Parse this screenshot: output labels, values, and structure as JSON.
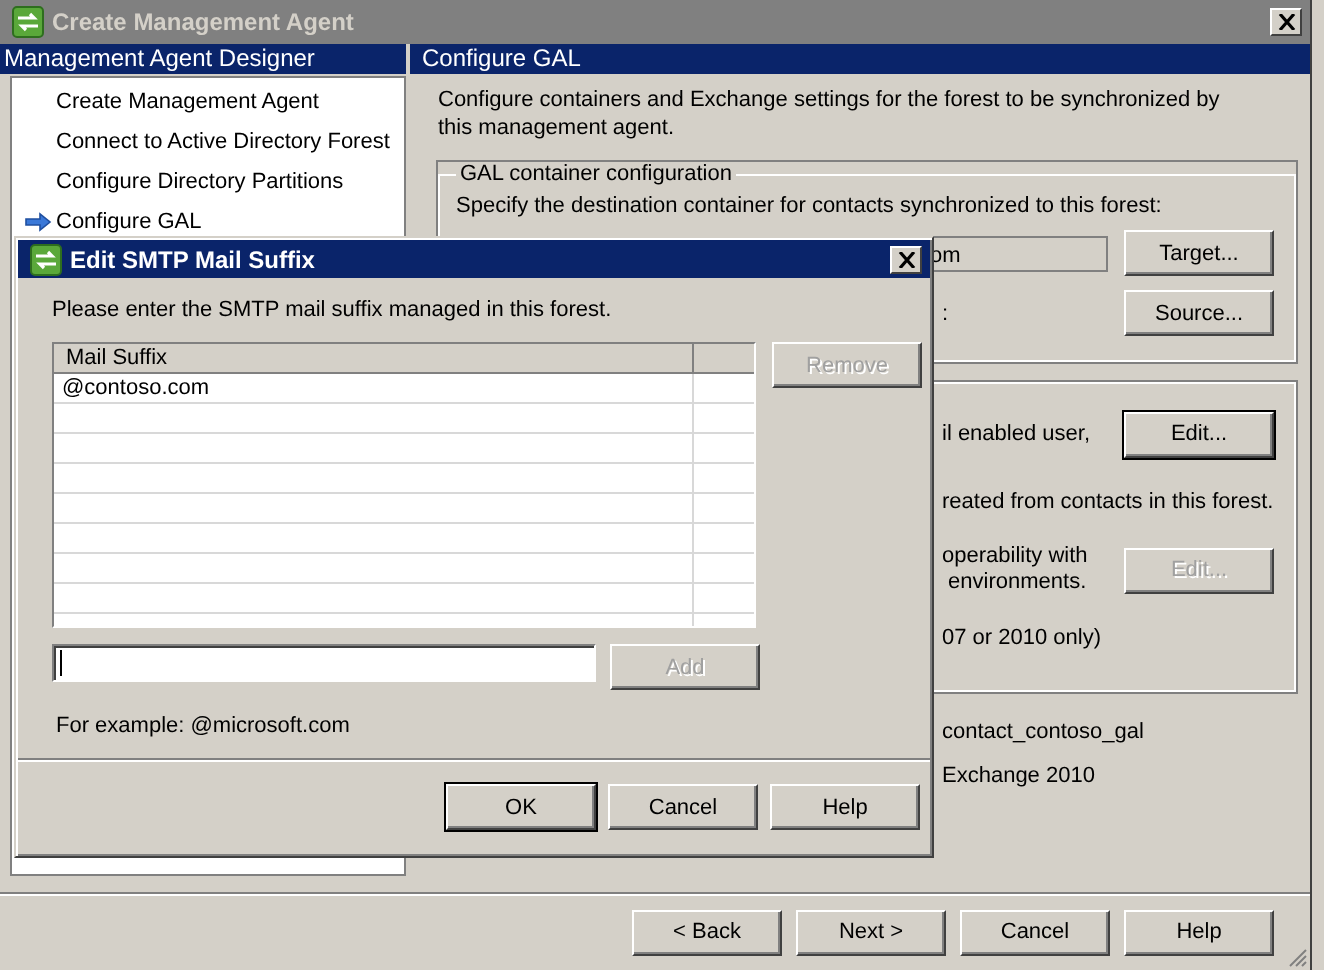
{
  "window": {
    "title": "Create Management Agent"
  },
  "sidebar": {
    "title": "Management Agent Designer",
    "items": [
      {
        "label": "Create Management Agent",
        "selected": false
      },
      {
        "label": "Connect to Active Directory Forest",
        "selected": false
      },
      {
        "label": "Configure Directory Partitions",
        "selected": false
      },
      {
        "label": "Configure GAL",
        "selected": true
      }
    ]
  },
  "page": {
    "title": "Configure GAL",
    "intro": "Configure containers and Exchange settings for the forest to be synchronized by this management agent.",
    "gal_container": {
      "legend": "GAL container configuration",
      "instruction": "Specify the destination container for contacts synchronized to this forest:",
      "container_value": "om",
      "target_button": {
        "label": "Target...",
        "disabled": false,
        "default": false
      },
      "source_text": ":",
      "source_button": {
        "label": "Source...",
        "disabled": false,
        "default": false
      }
    },
    "exchange_settings": {
      "rows": [
        {
          "lines": [
            "il enabled user,"
          ],
          "button": {
            "label": "Edit...",
            "disabled": false,
            "default": true
          }
        },
        {
          "lines": [
            "reated from contacts in this forest."
          ]
        },
        {
          "lines": [
            "operability with",
            " environments."
          ],
          "button": {
            "label": "Edit...",
            "disabled": true,
            "default": false
          }
        },
        {
          "lines": [
            "07 or 2010 only)"
          ]
        }
      ]
    },
    "values": [
      "contact_contoso_gal",
      "Exchange 2010"
    ]
  },
  "buttons": [
    {
      "label": "< Back",
      "disabled": false,
      "default": false
    },
    {
      "label": "Next >",
      "disabled": false,
      "default": false
    },
    {
      "label": "Cancel",
      "disabled": false,
      "default": false
    },
    {
      "label": "Help",
      "disabled": false,
      "default": false
    }
  ],
  "dialog": {
    "title": "Edit SMTP Mail Suffix",
    "prompt": "Please enter the SMTP mail suffix managed in this forest.",
    "list": {
      "columns": [
        "Mail Suffix"
      ],
      "rows": [
        "@contoso.com"
      ]
    },
    "remove_button": {
      "label": "Remove",
      "disabled": true,
      "default": false
    },
    "add_button": {
      "label": "Add",
      "disabled": true,
      "default": false
    },
    "example": "For example: @microsoft.com",
    "buttons": [
      {
        "label": "OK",
        "disabled": false,
        "default": true
      },
      {
        "label": "Cancel",
        "disabled": false,
        "default": false
      },
      {
        "label": "Help",
        "disabled": false,
        "default": false
      }
    ]
  }
}
